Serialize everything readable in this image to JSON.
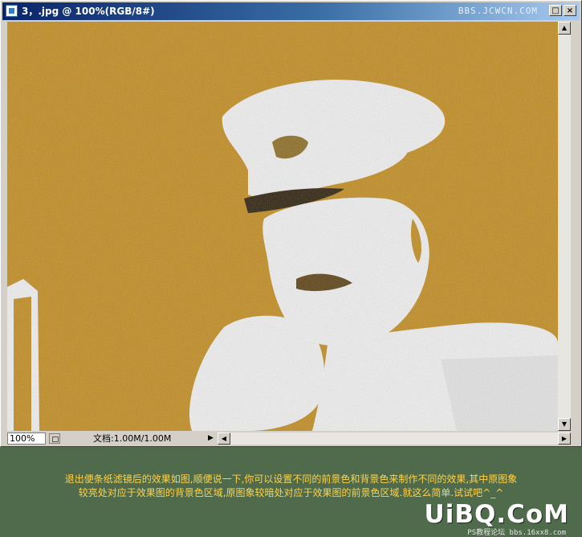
{
  "window": {
    "title": "3，.jpg @ 100%(RGB/8#)",
    "watermark": "BBS.JCWCN.COM",
    "colors": {
      "title_start": "#0a246a",
      "title_end": "#a6caf0",
      "canvas": "#c08a1c",
      "highlight": "#efefef"
    }
  },
  "status": {
    "zoom": "100%",
    "doc_info": "文档:1.00M/1.00M"
  },
  "caption": {
    "line1": "退出便条纸滤镜后的效果如图,顺便说一下,你可以设置不同的前景色和背景色来制作不同的效果,其中原图象",
    "line2": "较亮处对应于效果图的背景色区域,原图象较暗处对应于效果图的前景色区域.就这么简单.试试吧^_^"
  },
  "brand": {
    "logo": "UiBQ.CoM",
    "sub": "PS教程论坛 bbs.16xx8.com"
  }
}
